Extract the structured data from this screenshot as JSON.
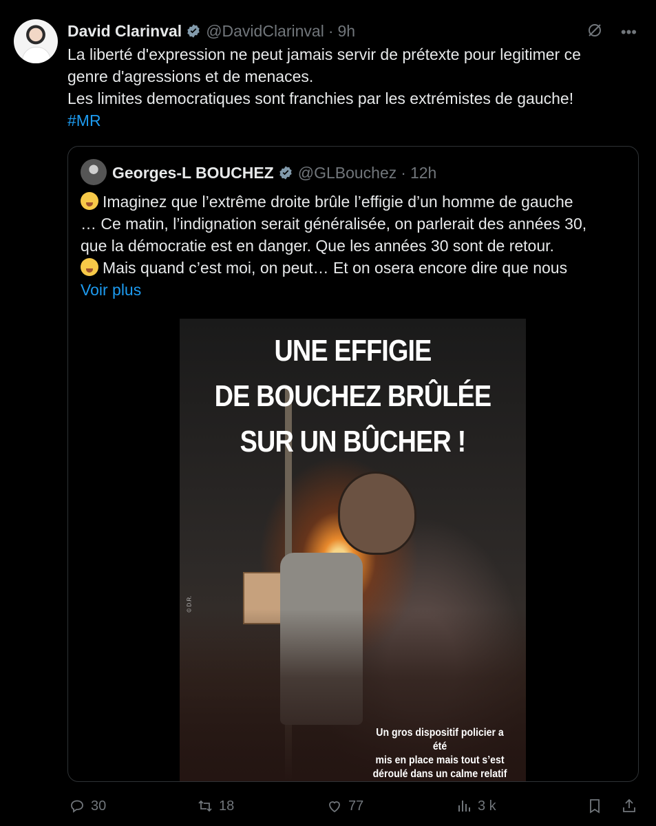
{
  "tweet": {
    "author_name": "David Clarinval",
    "author_handle": "@DavidClarinval",
    "dot": "·",
    "time": "9h",
    "lines": [
      "La liberté d'expression ne peut  jamais servir de prétexte pour legitimer ce",
      "genre d'agressions et de menaces.",
      "Les limites democratiques sont franchies par les extrémistes de gauche!"
    ],
    "hashtag": "#MR"
  },
  "quote": {
    "author_name": "Georges-L BOUCHEZ",
    "author_handle": "@GLBouchez",
    "dot": "·",
    "time": "12h",
    "lines": [
      "Imaginez que l’extrême droite brûle l’effigie d’un homme de gauche",
      "… Ce matin, l’indignation serait généralisée, on parlerait des années 30,",
      "que la démocratie est en danger. Que les années 30 sont de retour.",
      "Mais quand c’est moi, on peut… Et on osera encore dire que nous"
    ],
    "show_more": "Voir plus",
    "media": {
      "headline": [
        "UNE EFFIGIE",
        "DE BOUCHEZ BRÛLÉE",
        "SUR UN BÛCHER !"
      ],
      "caption": [
        "Un gros dispositif policier a été",
        "mis en place mais tout s’est",
        "déroulé dans un calme relatif"
      ],
      "credit": "© D.R."
    }
  },
  "actions": {
    "replies": "30",
    "reposts": "18",
    "likes": "77",
    "views": "3 k"
  },
  "colors": {
    "accent": "#1d9bf0",
    "muted": "#71767b",
    "verified": "#829aab"
  }
}
